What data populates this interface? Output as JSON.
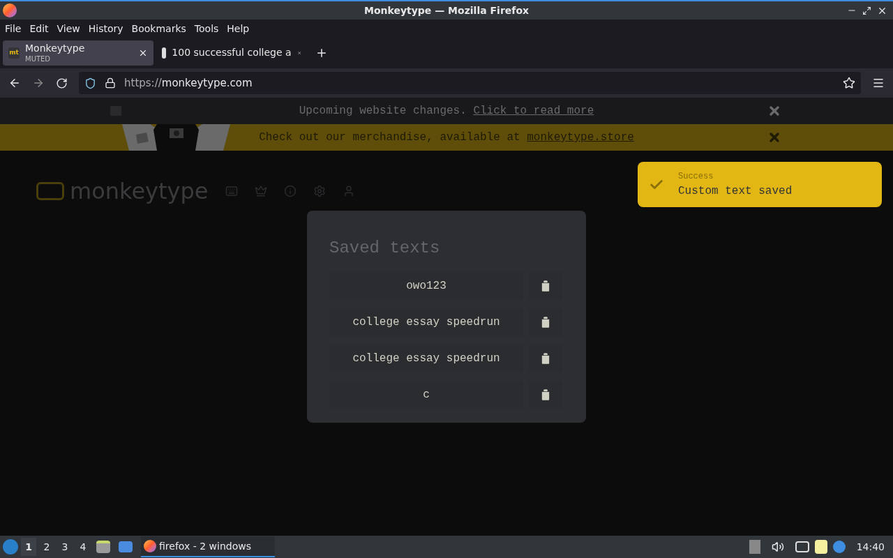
{
  "window": {
    "title": "Monkeytype — Mozilla Firefox"
  },
  "menu": [
    "File",
    "Edit",
    "View",
    "History",
    "Bookmarks",
    "Tools",
    "Help"
  ],
  "tabs": [
    {
      "label": "Monkeytype",
      "subtitle": "MUTED",
      "selected": true,
      "favicon": "mt"
    },
    {
      "label": "100 successful college a",
      "selected": false
    }
  ],
  "address": {
    "scheme": "https://",
    "host": "monkeytype.com"
  },
  "banners": [
    {
      "kind": "notice",
      "text": "Upcoming website changes.",
      "link": "Click to read more"
    },
    {
      "kind": "merch",
      "text": "Check out our merchandise, available at",
      "link": "monkeytype.store"
    }
  ],
  "site": {
    "logo": "monkeytype"
  },
  "notification": {
    "title": "Success",
    "message": "Custom text saved"
  },
  "modal": {
    "title": "Saved texts",
    "items": [
      {
        "label": "owo123"
      },
      {
        "label": "college essay speedrun"
      },
      {
        "label": "college essay speedrun"
      },
      {
        "label": "c"
      }
    ]
  },
  "taskbar": {
    "workspaces": [
      {
        "label": "1",
        "selected": true
      },
      {
        "label": "2",
        "selected": false
      },
      {
        "label": "3",
        "selected": false
      },
      {
        "label": "4",
        "selected": false
      }
    ],
    "task": "firefox - 2 windows",
    "clock": "14:40"
  }
}
